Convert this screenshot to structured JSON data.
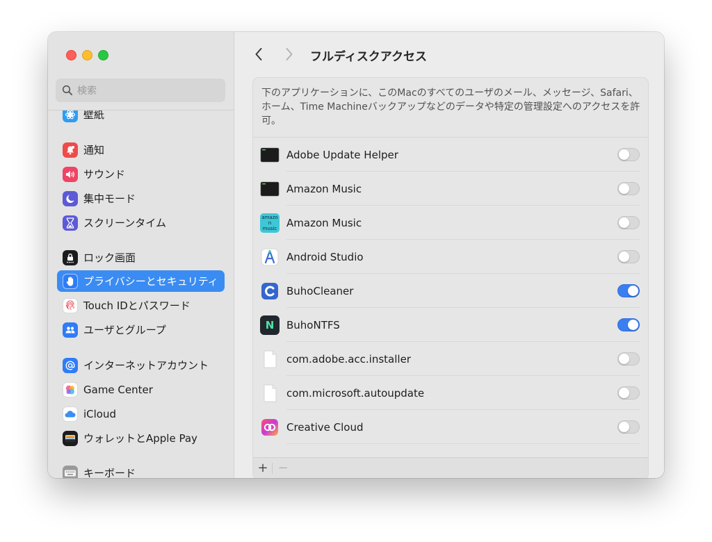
{
  "sidebar": {
    "search_placeholder": "検索",
    "items": [
      {
        "label": "壁紙",
        "icon": "wallpaper-icon",
        "color": "#2f9cf2"
      },
      {
        "label": "通知",
        "icon": "bell-icon",
        "color": "#ee4b4a"
      },
      {
        "label": "サウンド",
        "icon": "speaker-icon",
        "color": "#ee4565"
      },
      {
        "label": "集中モード",
        "icon": "moon-icon",
        "color": "#5d5ad6"
      },
      {
        "label": "スクリーンタイム",
        "icon": "hourglass-icon",
        "color": "#5d5ad6"
      },
      {
        "label": "ロック画面",
        "icon": "lock-icon",
        "color": "#1c1c1e"
      },
      {
        "label": "プライバシーとセキュリティ",
        "icon": "hand-icon",
        "color": "#2f7cf6",
        "selected": true
      },
      {
        "label": "Touch IDとパスワード",
        "icon": "fingerprint-icon",
        "color": "#ffffff"
      },
      {
        "label": "ユーザとグループ",
        "icon": "users-icon",
        "color": "#2f7cf6"
      },
      {
        "label": "インターネットアカウント",
        "icon": "at-icon",
        "color": "#2f7cf6"
      },
      {
        "label": "Game Center",
        "icon": "game-center-icon",
        "color": "#ffffff"
      },
      {
        "label": "iCloud",
        "icon": "cloud-icon",
        "color": "#ffffff"
      },
      {
        "label": "ウォレットとApple Pay",
        "icon": "wallet-icon",
        "color": "#1c1c1e"
      },
      {
        "label": "キーボード",
        "icon": "keyboard-icon",
        "color": "#9a9a9a"
      }
    ]
  },
  "header": {
    "title": "フルディスクアクセス"
  },
  "panel": {
    "description": "下のアプリケーションに、このMacのすべてのユーザのメール、メッセージ、Safari、ホーム、Time Machineバックアップなどのデータや特定の管理設定へのアクセスを許可。",
    "apps": [
      {
        "name": "Adobe Update Helper",
        "icon": "terminal-icon",
        "enabled": false
      },
      {
        "name": "Amazon Music",
        "icon": "terminal-icon",
        "enabled": false
      },
      {
        "name": "Amazon Music",
        "icon": "amazon-music-icon",
        "icon_text": "amazon music",
        "enabled": false
      },
      {
        "name": "Android Studio",
        "icon": "android-studio-icon",
        "enabled": false
      },
      {
        "name": "BuhoCleaner",
        "icon": "buhocleaner-icon",
        "enabled": true
      },
      {
        "name": "BuhoNTFS",
        "icon": "buhontfs-icon",
        "icon_text": "N",
        "enabled": true
      },
      {
        "name": "com.adobe.acc.installer",
        "icon": "document-icon",
        "enabled": false
      },
      {
        "name": "com.microsoft.autoupdate",
        "icon": "document-icon",
        "enabled": false
      },
      {
        "name": "Creative Cloud",
        "icon": "creative-cloud-icon",
        "enabled": false
      }
    ],
    "footer": {
      "add_label": "+",
      "remove_label": "−"
    }
  },
  "colors": {
    "accent": "#3b7ef0",
    "selected_sidebar": "#3b8cf2"
  }
}
